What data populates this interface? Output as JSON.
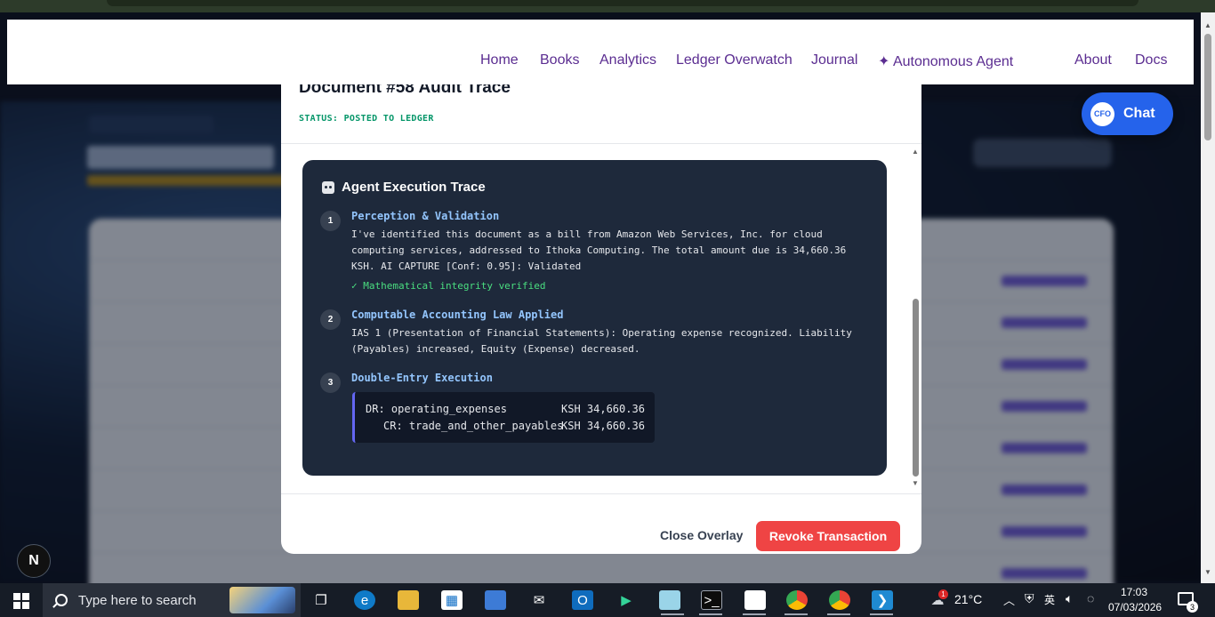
{
  "navbar": {
    "links": [
      "Home",
      "Books",
      "Analytics",
      "Ledger Overwatch",
      "Journal",
      "✦ Autonomous Agent",
      "About",
      "Docs"
    ]
  },
  "chat": {
    "badge": "CFO",
    "label": "Chat"
  },
  "modal": {
    "title": "Document #58 Audit Trace",
    "status": "STATUS: POSTED TO LEDGER",
    "trace_title": "Agent Execution Trace",
    "steps": [
      {
        "number": "1",
        "title": "Perception & Validation",
        "body": "I've identified this document as a bill from Amazon Web Services, Inc. for cloud computing services, addressed to Ithoka Computing. The total amount due is 34,660.36 KSH. AI CAPTURE [Conf: 0.95]: Validated",
        "verified": "✓ Mathematical integrity verified"
      },
      {
        "number": "2",
        "title": "Computable Accounting Law Applied",
        "body": "IAS 1 (Presentation of Financial Statements): Operating expense recognized. Liability (Payables) increased, Equity (Expense) decreased."
      },
      {
        "number": "3",
        "title": "Double-Entry Execution",
        "entries": [
          {
            "side": "DR: operating_expenses",
            "amount": "KSH 34,660.36"
          },
          {
            "side": "CR: trade_and_other_payables",
            "amount": "KSH 34,660.36"
          }
        ]
      }
    ],
    "close_label": "Close Overlay",
    "revoke_label": "Revoke Transaction",
    "accent_colors": {
      "revoke": "#ef4444",
      "status": "#059669",
      "step_title": "#93c5fd"
    }
  },
  "dev_badge": "N",
  "taskbar": {
    "search_placeholder": "Type here to search",
    "weather_temp": "21°C",
    "weather_alert": "1",
    "ime": "英",
    "time": "17:03",
    "date": "07/03/2026",
    "notification_count": "3",
    "apps": [
      "task-view",
      "edge",
      "file-explorer",
      "store",
      "remote-desktop",
      "mail",
      "outlook",
      "play-store",
      "notepad-app",
      "terminal",
      "file",
      "chrome",
      "chrome-profile",
      "vscode"
    ]
  }
}
